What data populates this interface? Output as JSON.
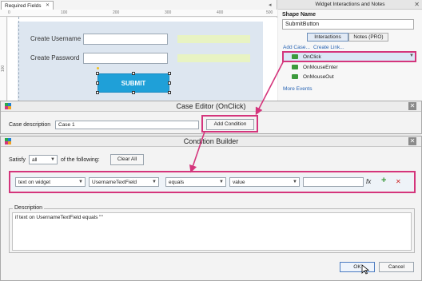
{
  "colors": {
    "accent_pink": "#d4357c",
    "button_blue": "#1fa0d8",
    "link_blue": "#2864b4",
    "add_green": "#3c9a3c",
    "remove_red": "#cc2222"
  },
  "canvas": {
    "tab_label": "Required Fields",
    "tab_close": "✕",
    "tab_scroll": "◂",
    "ruler_top": [
      "0",
      "100",
      "200",
      "300",
      "400",
      "500"
    ],
    "ruler_left": [
      "100"
    ],
    "username_label": "Create Username",
    "password_label": "Create Password",
    "submit_label": "SUBMIT"
  },
  "right_panel": {
    "title": "Widget Interactions and Notes",
    "close": "✕",
    "shape_name_label": "Shape Name",
    "shape_name_value": "SubmitButton",
    "tab_interactions": "Interactions",
    "tab_notes": "Notes (PRO)",
    "add_case": "Add Case...",
    "create_link": "Create Link...",
    "events": [
      "OnClick",
      "OnMouseEnter",
      "OnMouseOut"
    ],
    "more_events": "More Events"
  },
  "case_editor": {
    "title": "Case Editor (OnClick)",
    "close": "✕",
    "description_label": "Case description",
    "description_value": "Case 1",
    "add_condition": "Add Condition"
  },
  "condition_builder": {
    "title": "Condition Builder",
    "close": "✕",
    "satisfy_label": "Satisfy",
    "satisfy_value": "all",
    "of_following": "of the following:",
    "clear_all": "Clear All",
    "condition": {
      "type": "text on widget",
      "widget": "UsernameTextField",
      "operator": "equals",
      "value_type": "value",
      "value": "",
      "fx": "fx",
      "add": "+",
      "remove": "✕"
    },
    "description_label": "Description",
    "description_text": "if text on UsernameTextField equals \"\"",
    "ok": "OK",
    "cancel": "Cancel"
  }
}
